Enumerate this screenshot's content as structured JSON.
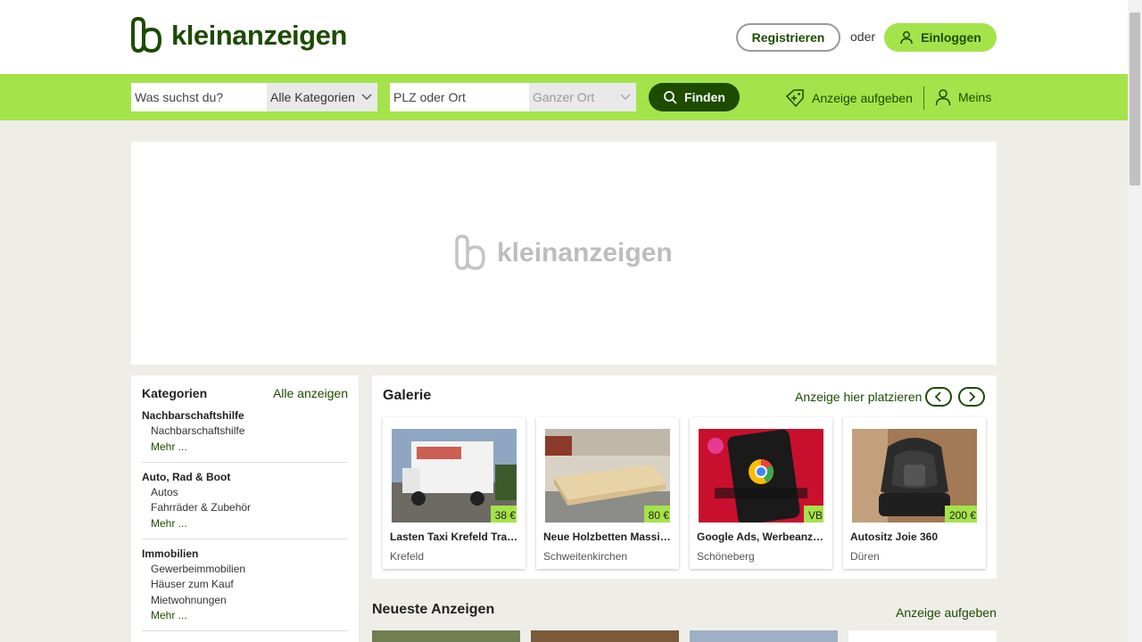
{
  "header": {
    "logo_text": "kleinanzeigen",
    "register_label": "Registrieren",
    "or_text": "oder",
    "login_label": "Einloggen"
  },
  "search": {
    "query_placeholder": "Was suchst du?",
    "category_value": "Alle Kategorien",
    "location_placeholder": "PLZ oder Ort",
    "radius_value": "Ganzer Ort",
    "find_label": "Finden",
    "post_ad_label": "Anzeige aufgeben",
    "my_label": "Meins"
  },
  "banner": {
    "logo_text": "kleinanzeigen"
  },
  "sidebar": {
    "title": "Kategorien",
    "all_label": "Alle anzeigen",
    "categories": [
      {
        "name": "Nachbarschaftshilfe",
        "subs": [
          "Nachbarschaftshilfe"
        ],
        "more": "Mehr ..."
      },
      {
        "name": "Auto, Rad & Boot",
        "subs": [
          "Autos",
          "Fahrräder & Zubehör"
        ],
        "more": "Mehr ..."
      },
      {
        "name": "Immobilien",
        "subs": [
          "Gewerbeimmobilien",
          "Häuser zum Kauf",
          "Mietwohnungen"
        ],
        "more": "Mehr ..."
      }
    ]
  },
  "gallery": {
    "title": "Galerie",
    "place_label": "Anzeige hier platzieren",
    "prev_icon": "chevron-left-icon",
    "next_icon": "chevron-right-icon",
    "items": [
      {
        "title": "Lasten Taxi Krefeld Transporter",
        "location": "Krefeld",
        "price": "38 €"
      },
      {
        "title": "Neue Holzbetten Massivholz",
        "location": "Schweitenkirchen",
        "price": "80 €"
      },
      {
        "title": "Google Ads, Werbeanzeigen",
        "location": "Schöneberg",
        "price": "VB"
      },
      {
        "title": "Autositz Joie 360",
        "location": "Düren",
        "price": "200 €"
      }
    ]
  },
  "newest": {
    "title": "Neueste Anzeigen",
    "post_label": "Anzeige aufgeben"
  },
  "colors": {
    "brand_green": "#1d4b00",
    "accent_lime": "#a5e34a",
    "page_bg": "#efede8"
  }
}
